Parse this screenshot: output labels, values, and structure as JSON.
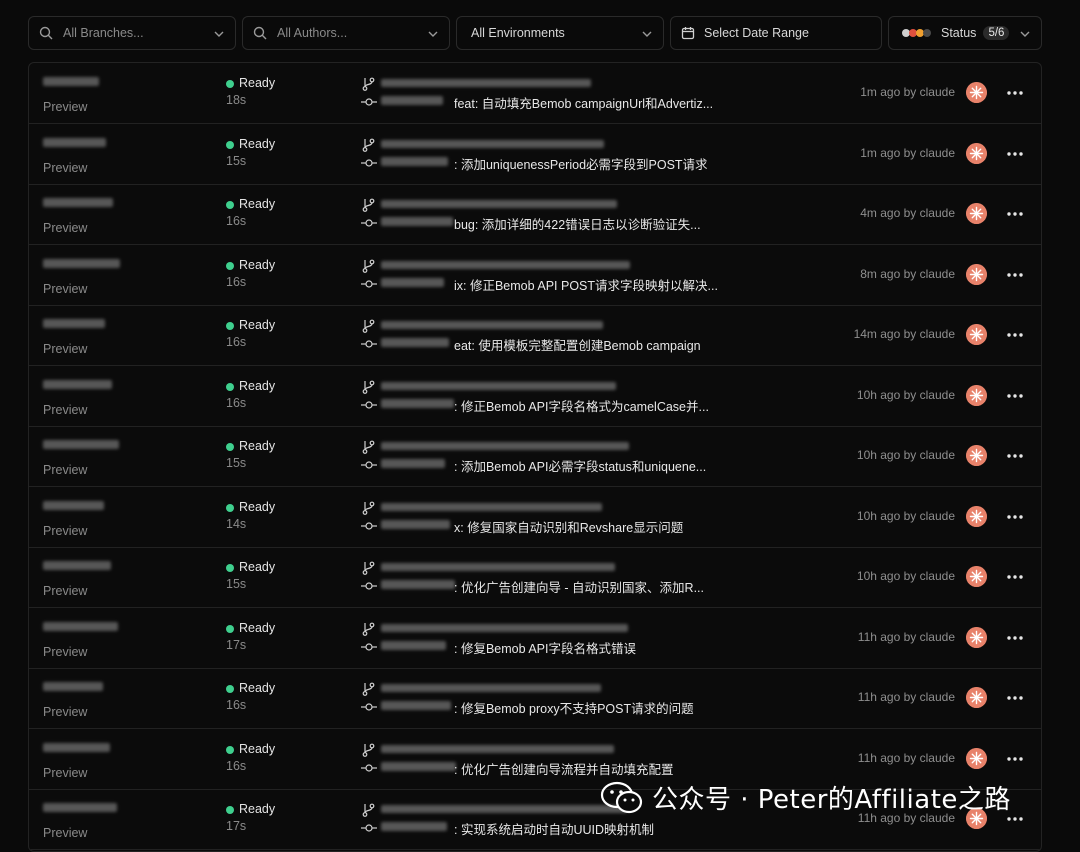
{
  "filters": {
    "branches_placeholder": "All Branches...",
    "authors_placeholder": "All Authors...",
    "environments_label": "All Environments",
    "date_range_label": "Select Date Range",
    "status_label": "Status",
    "status_count": "5/6"
  },
  "colors": {
    "ready": "#3fcf8e",
    "avatar": "#e8826a",
    "status_dots": [
      "#3fcf8e",
      "#e0503e",
      "#f0a030",
      "#cfcfcf"
    ]
  },
  "deployments": [
    {
      "env": "Preview",
      "state": "Ready",
      "duration": "18s",
      "message": "feat: 自动填充Bemob campaignUrl和Advertiz...",
      "time": "1m ago",
      "author": "claude"
    },
    {
      "env": "Preview",
      "state": "Ready",
      "duration": "15s",
      "message": ": 添加uniquenessPeriod必需字段到POST请求",
      "time": "1m ago",
      "author": "claude"
    },
    {
      "env": "Preview",
      "state": "Ready",
      "duration": "16s",
      "message": "bug: 添加详细的422错误日志以诊断验证失...",
      "time": "4m ago",
      "author": "claude"
    },
    {
      "env": "Preview",
      "state": "Ready",
      "duration": "16s",
      "message": "ix: 修正Bemob API POST请求字段映射以解决...",
      "time": "8m ago",
      "author": "claude"
    },
    {
      "env": "Preview",
      "state": "Ready",
      "duration": "16s",
      "message": "eat: 使用模板完整配置创建Bemob campaign",
      "time": "14m ago",
      "author": "claude"
    },
    {
      "env": "Preview",
      "state": "Ready",
      "duration": "16s",
      "message": ": 修正Bemob API字段名格式为camelCase并...",
      "time": "10h ago",
      "author": "claude"
    },
    {
      "env": "Preview",
      "state": "Ready",
      "duration": "15s",
      "message": ": 添加Bemob API必需字段status和uniquene...",
      "time": "10h ago",
      "author": "claude"
    },
    {
      "env": "Preview",
      "state": "Ready",
      "duration": "14s",
      "message": "x: 修复国家自动识别和Revshare显示问题",
      "time": "10h ago",
      "author": "claude"
    },
    {
      "env": "Preview",
      "state": "Ready",
      "duration": "15s",
      "message": ": 优化广告创建向导 - 自动识别国家、添加R...",
      "time": "10h ago",
      "author": "claude"
    },
    {
      "env": "Preview",
      "state": "Ready",
      "duration": "17s",
      "message": ": 修复Bemob API字段名格式错误",
      "time": "11h ago",
      "author": "claude"
    },
    {
      "env": "Preview",
      "state": "Ready",
      "duration": "16s",
      "message": ": 修复Bemob proxy不支持POST请求的问题",
      "time": "11h ago",
      "author": "claude"
    },
    {
      "env": "Preview",
      "state": "Ready",
      "duration": "16s",
      "message": ": 优化广告创建向导流程并自动填充配置",
      "time": "11h ago",
      "author": "claude"
    },
    {
      "env": "Preview",
      "state": "Ready",
      "duration": "17s",
      "message": ": 实现系统启动时自动UUID映射机制",
      "time": "11h ago",
      "author": "claude"
    }
  ],
  "watermark": {
    "text": "公众号 · Peter的Affiliate之路"
  }
}
